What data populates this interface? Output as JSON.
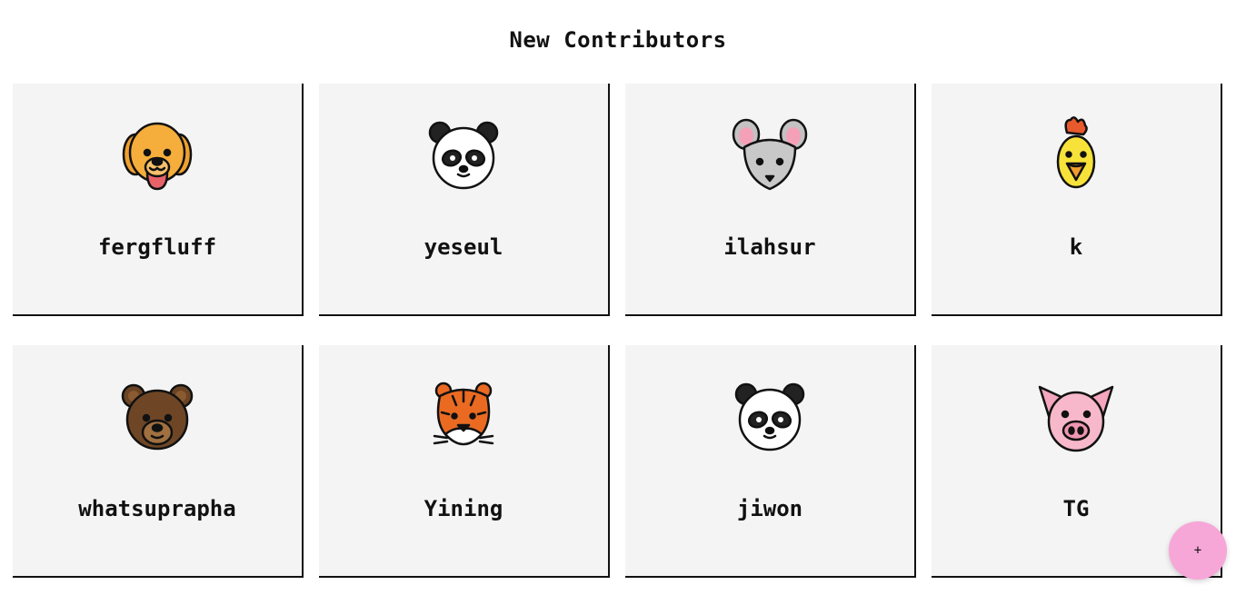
{
  "title": "New Contributors",
  "contributors": [
    {
      "name": "fergfluff",
      "icon": "dog-icon"
    },
    {
      "name": "yeseul",
      "icon": "panda-icon"
    },
    {
      "name": "ilahsur",
      "icon": "mouse-icon"
    },
    {
      "name": "k",
      "icon": "chick-icon"
    },
    {
      "name": "whatsuprapha",
      "icon": "bear-icon"
    },
    {
      "name": "Yining",
      "icon": "tiger-icon"
    },
    {
      "name": "jiwon",
      "icon": "panda-icon"
    },
    {
      "name": "TG",
      "icon": "pig-icon"
    }
  ],
  "fab": {
    "label": "+",
    "color": "#f7a6d8"
  },
  "colors": {
    "card_bg": "#f4f4f4",
    "border": "#111111"
  }
}
